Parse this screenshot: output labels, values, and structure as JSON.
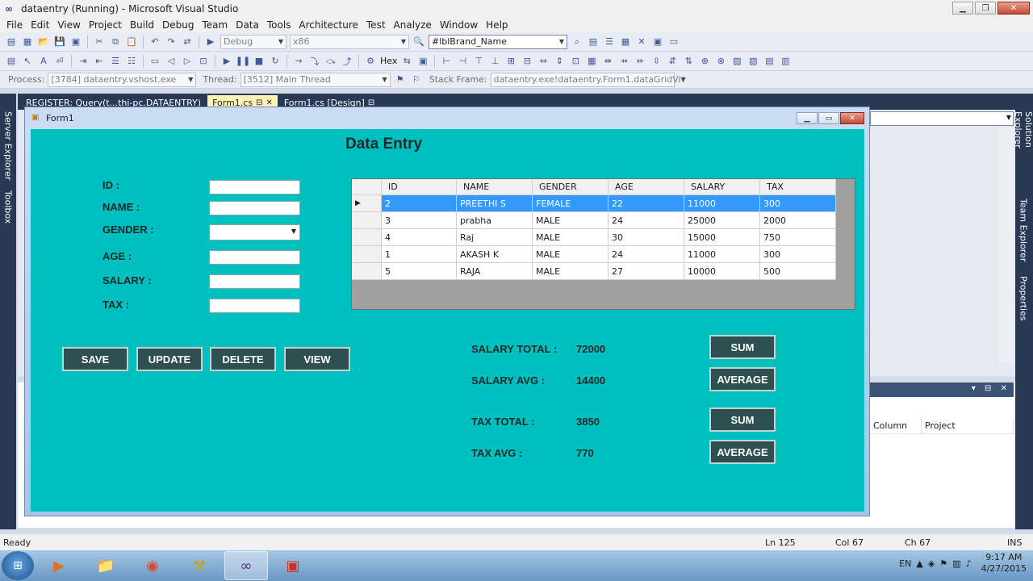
{
  "vs": {
    "title": "dataentry (Running) - Microsoft Visual Studio",
    "menu": [
      "File",
      "Edit",
      "View",
      "Project",
      "Build",
      "Debug",
      "Team",
      "Data",
      "Tools",
      "Architecture",
      "Test",
      "Analyze",
      "Window",
      "Help"
    ],
    "toolbar": {
      "config": "Debug",
      "platform": "x86",
      "find": "#lblBrand_Name",
      "hex_label": "Hex"
    },
    "debug_location": {
      "process_label": "Process:",
      "process": "[3784] dataentry.vshost.exe",
      "thread_label": "Thread:",
      "thread": "[3512] Main Thread",
      "frame_label": "Stack Frame:",
      "frame": "dataentry.exe!dataentry.Form1.dataGridVi"
    },
    "side_tabs_left": [
      "Server Explorer",
      "Toolbox"
    ],
    "side_tabs_right": [
      "Solution Explorer",
      "Team Explorer",
      "Properties"
    ],
    "doc_tabs": [
      {
        "label": "REGISTER: Query(t...thi-pc.DATAENTRY)"
      },
      {
        "label": "Form1.cs"
      },
      {
        "label": "Form1.cs [Design]"
      }
    ],
    "error_columns": [
      "Column",
      "Project"
    ],
    "status": {
      "ready": "Ready",
      "ln": "Ln 125",
      "col": "Col 67",
      "ch": "Ch 67",
      "ins": "INS"
    }
  },
  "taskbar": {
    "lang": "EN",
    "time": "9:17 AM",
    "date": "4/27/2015"
  },
  "form": {
    "title": "Form1",
    "heading": "Data Entry",
    "fields": {
      "id": "ID  :",
      "name": "NAME  :",
      "gender": "GENDER  :",
      "age": "AGE  :",
      "salary": "SALARY  :",
      "tax": "TAX  :"
    },
    "buttons": {
      "save": "SAVE",
      "update": "UPDATE",
      "delete": "DELETE",
      "view": "VIEW"
    },
    "grid": {
      "columns": [
        "ID",
        "NAME",
        "GENDER",
        "AGE",
        "SALARY",
        "TAX"
      ],
      "rows": [
        [
          "2",
          "PREETHI S",
          "FEMALE",
          "22",
          "11000",
          "300"
        ],
        [
          "3",
          "prabha",
          "MALE",
          "24",
          "25000",
          "2000"
        ],
        [
          "4",
          "Raj",
          "MALE",
          "30",
          "15000",
          "750"
        ],
        [
          "1",
          "AKASH K",
          "MALE",
          "24",
          "11000",
          "300"
        ],
        [
          "5",
          "RAJA",
          "MALE",
          "27",
          "10000",
          "500"
        ]
      ]
    },
    "summary": {
      "salary_total_label": "SALARY TOTAL  :",
      "salary_total": "72000",
      "salary_avg_label": "SALARY AVG  :",
      "salary_avg": "14400",
      "tax_total_label": "TAX TOTAL  :",
      "tax_total": "3850",
      "tax_avg_label": "TAX AVG  :",
      "tax_avg": "770"
    },
    "calc_buttons": {
      "sum1": "SUM",
      "avg1": "AVERAGE",
      "sum2": "SUM",
      "avg2": "AVERAGE"
    }
  }
}
